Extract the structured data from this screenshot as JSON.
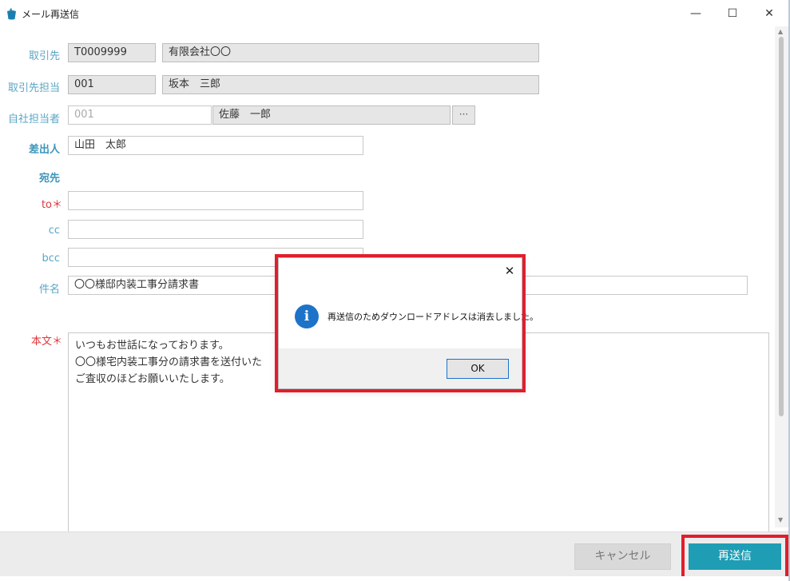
{
  "window": {
    "title": "メール再送信",
    "minimize": "—",
    "maximize": "☐",
    "close": "✕"
  },
  "form": {
    "client": {
      "label": "取引先",
      "code": "T0009999",
      "name": "有限会社〇〇"
    },
    "client_contact": {
      "label": "取引先担当",
      "code": "001",
      "name": "坂本　三郎"
    },
    "own_contact": {
      "label": "自社担当者",
      "code": "001",
      "name": "佐藤　一郎",
      "lookup": "···"
    },
    "sender": {
      "label": "差出人",
      "value": "山田　太郎"
    },
    "recipients_heading": "宛先",
    "to": {
      "label": "to＊",
      "value": ""
    },
    "cc": {
      "label": "cc",
      "value": ""
    },
    "bcc": {
      "label": "bcc",
      "value": ""
    },
    "subject": {
      "label": "件名",
      "value": "〇〇様邸内装工事分請求書"
    },
    "body": {
      "label": "本文＊",
      "lines": [
        "いつもお世話になっております。",
        "〇〇様宅内装工事分の請求書を送付いた",
        "ご査収のほどお願いいたします。"
      ]
    }
  },
  "footer": {
    "cancel": "キャンセル",
    "resend": "再送信"
  },
  "dialog": {
    "close": "✕",
    "icon": "i",
    "message": "再送信のためダウンロードアドレスは消去しました。",
    "ok": "OK"
  },
  "colors": {
    "accent": "#1e9db4",
    "label": "#5ba6c5",
    "required": "#e0353c",
    "highlight": "#e01e2d",
    "info_icon": "#1d73c8"
  }
}
